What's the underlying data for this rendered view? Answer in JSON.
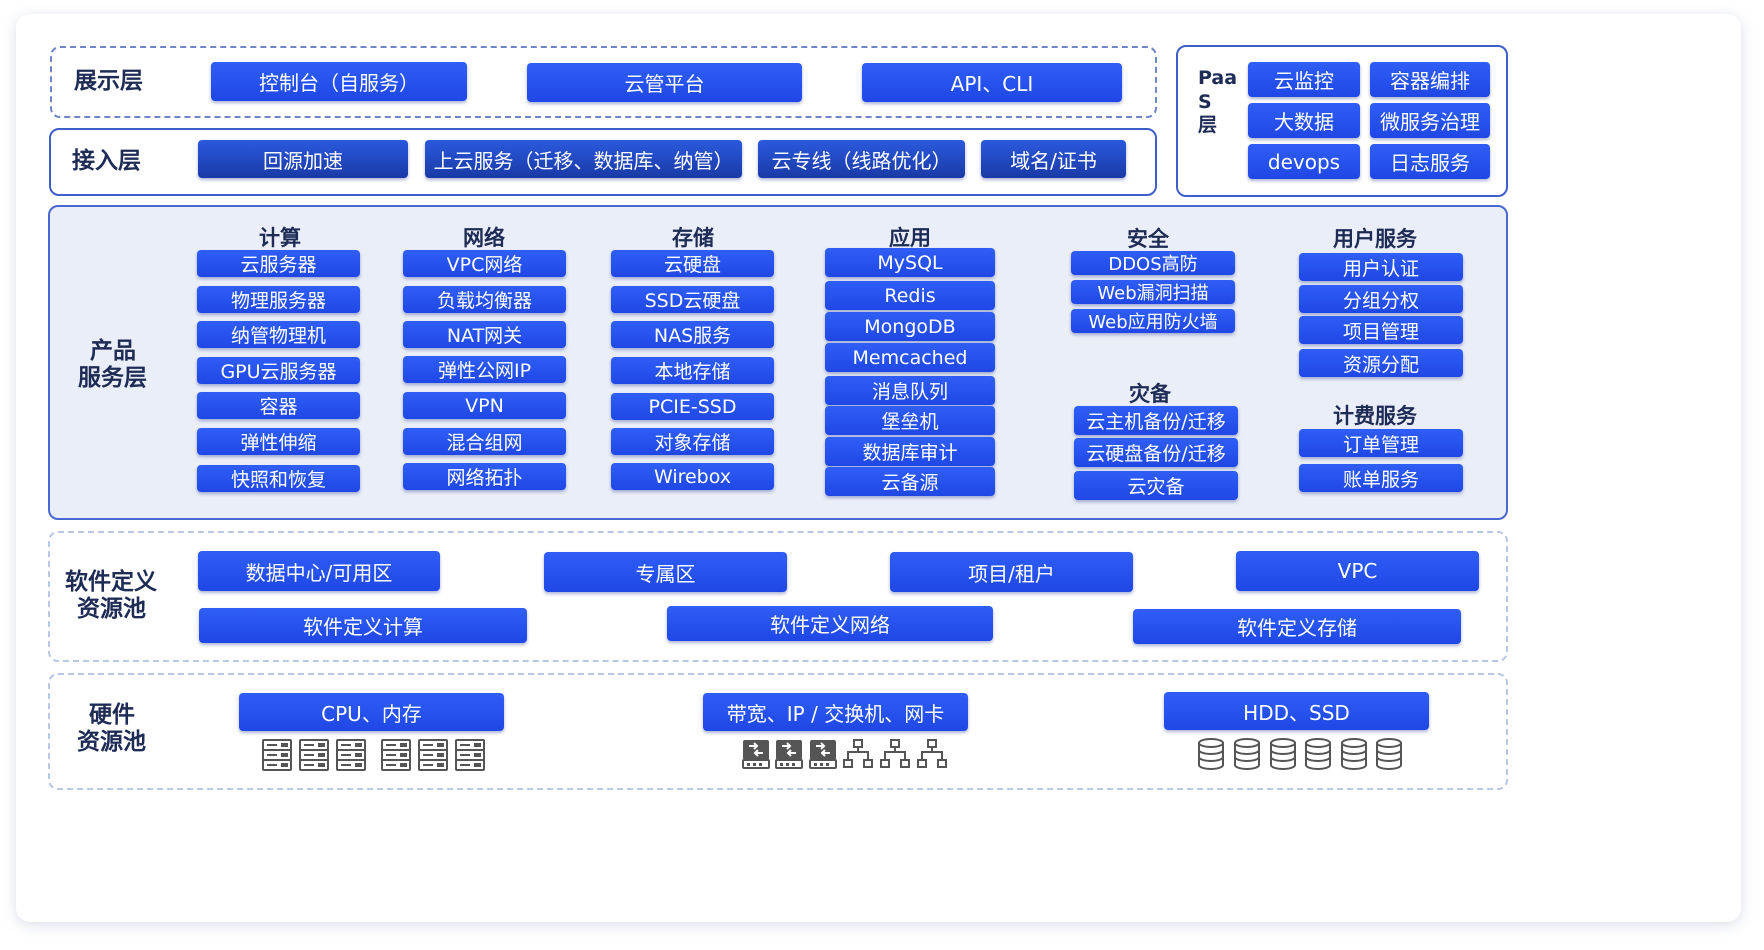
{
  "display_layer": {
    "label": "展示层",
    "items": [
      "控制台（自服务）",
      "云管平台",
      "API、CLI"
    ]
  },
  "access_layer": {
    "label": "接入层",
    "items": [
      "回源加速",
      "上云服务（迁移、数据库、纳管）",
      "云专线（线路优化）",
      "域名/证书"
    ]
  },
  "paas_layer": {
    "label_lines": [
      "Paa",
      "S",
      "层"
    ],
    "items": [
      "云监控",
      "容器编排",
      "大数据",
      "微服务治理",
      "devops",
      "日志服务"
    ]
  },
  "product_layer": {
    "label_lines": [
      "产品",
      "服务层"
    ],
    "compute": {
      "title": "计算",
      "items": [
        "云服务器",
        "物理服务器",
        "纳管物理机",
        "GPU云服务器",
        "容器",
        "弹性伸缩",
        "快照和恢复"
      ]
    },
    "network": {
      "title": "网络",
      "items": [
        "VPC网络",
        "负载均衡器",
        "NAT网关",
        "弹性公网IP",
        "VPN",
        "混合组网",
        "网络拓扑"
      ]
    },
    "storage": {
      "title": "存储",
      "items": [
        "云硬盘",
        "SSD云硬盘",
        "NAS服务",
        "本地存储",
        "PCIE-SSD",
        "对象存储",
        "Wirebox"
      ]
    },
    "application": {
      "title": "应用",
      "items": [
        "MySQL",
        "Redis",
        "MongoDB",
        "Memcached",
        "消息队列",
        "堡垒机",
        "数据库审计",
        "云备源"
      ]
    },
    "security": {
      "title": "安全",
      "items": [
        "DDOS高防",
        "Web漏洞扫描",
        "Web应用防火墙"
      ]
    },
    "disaster": {
      "title": "灾备",
      "items": [
        "云主机备份/迁移",
        "云硬盘备份/迁移",
        "云灾备"
      ]
    },
    "user_service": {
      "title": "用户服务",
      "items": [
        "用户认证",
        "分组分权",
        "项目管理",
        "资源分配"
      ]
    },
    "billing_service": {
      "title": "计费服务",
      "items": [
        "订单管理",
        "账单服务"
      ]
    }
  },
  "sdn_layer": {
    "label_lines": [
      "软件定义",
      "资源池"
    ],
    "row1": [
      "数据中心/可用区",
      "专属区",
      "项目/租户",
      "VPC"
    ],
    "row2": [
      "软件定义计算",
      "软件定义网络",
      "软件定义存储"
    ]
  },
  "hardware_layer": {
    "label_lines": [
      "硬件",
      "资源池"
    ],
    "items": [
      "CPU、内存",
      "带宽、IP / 交换机、网卡",
      "HDD、SSD"
    ],
    "icons": {
      "compute": "server-rack-icon",
      "network_switch": "network-switch-icon",
      "network_topology": "network-topology-icon",
      "storage": "database-disk-icon"
    }
  },
  "colors": {
    "button_blue": "#2450ee",
    "label_navy": "#1d2b55",
    "border_blue": "#3f5fc8",
    "product_bg": "#eaeef8",
    "icon_gray": "#555555"
  }
}
